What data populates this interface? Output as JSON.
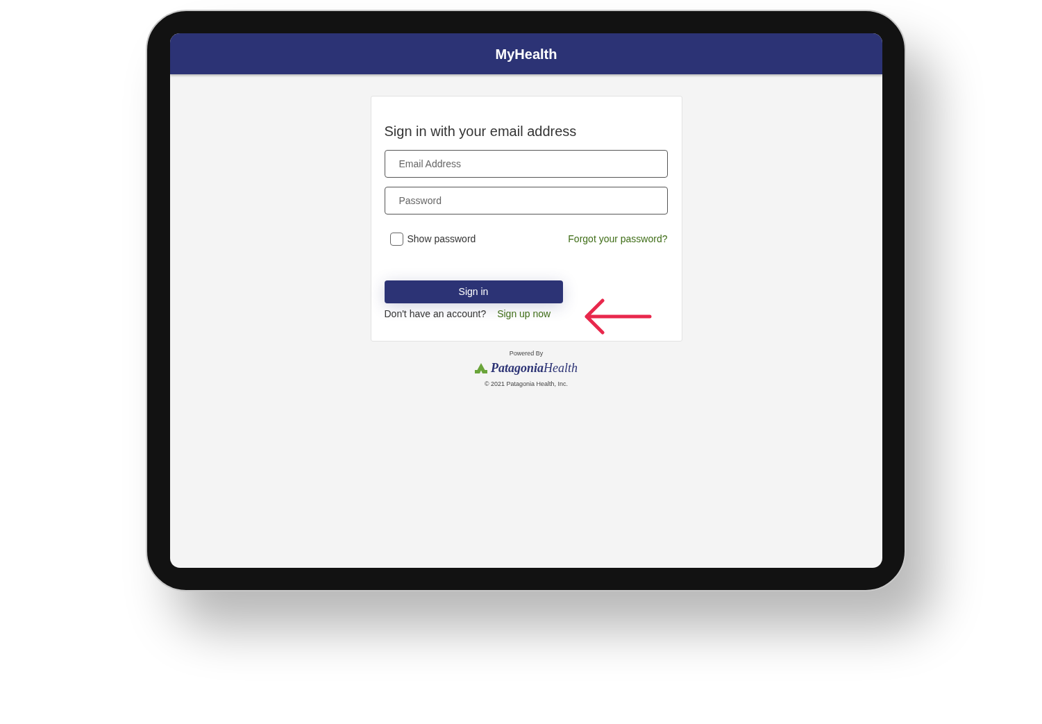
{
  "app_bar": {
    "title": "MyHealth"
  },
  "sign_in_form": {
    "heading": "Sign in with your email address",
    "fields": [
      {
        "placeholder": "Email Address"
      },
      {
        "placeholder": "Password"
      }
    ],
    "show_password": {
      "label": "Show password",
      "checked": false
    },
    "forgot_password_link": "Forgot your password?",
    "submit_button": "Sign in",
    "signup_prompt": "Don't have an account?",
    "signup_link": "Sign up now"
  },
  "footer": {
    "powered_by": "Powered By",
    "logo_text": "**Patagonia**Health",
    "copyright": "© 2021 Patagonia Health, Inc."
  }
}
